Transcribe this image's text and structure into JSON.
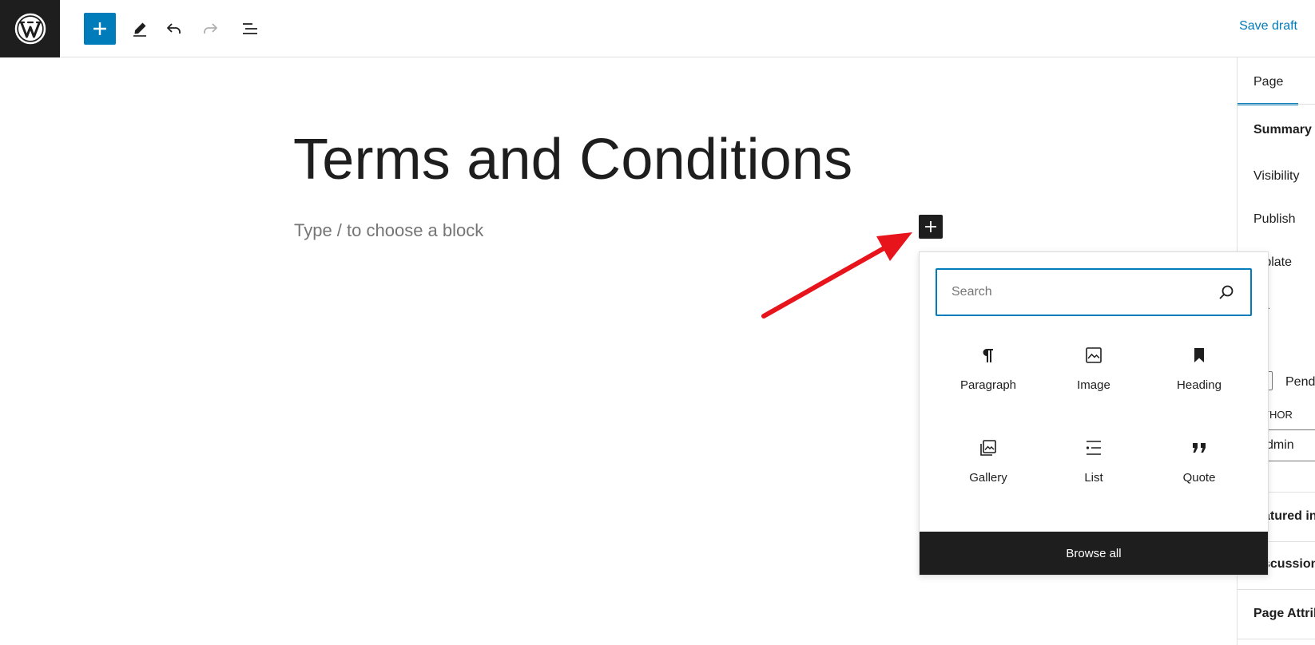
{
  "toolbar": {
    "logo": "wordpress-logo",
    "inserter_icon": "plus-icon",
    "tools_icon": "pencil-icon",
    "undo_icon": "undo-icon",
    "redo_icon": "redo-icon",
    "outline_icon": "list-view-icon",
    "save_draft_label": "Save draft"
  },
  "editor": {
    "title": "Terms and Conditions",
    "block_placeholder": "Type / to choose a block"
  },
  "sidebar": {
    "tab_page": "Page",
    "summary": "Summary",
    "visibility": "Visibility",
    "publish": "Publish",
    "template": "mplate",
    "url": "RL",
    "pending": "Pend",
    "author_label": "THOR",
    "author_value": "dmin",
    "featured_image": "atured in",
    "discussion": "scussion",
    "page_attributes": "Page Attrib"
  },
  "quick_inserter": {
    "search_placeholder": "Search",
    "search_value": "",
    "blocks": [
      {
        "label": "Paragraph",
        "icon": "paragraph-icon"
      },
      {
        "label": "Image",
        "icon": "image-icon"
      },
      {
        "label": "Heading",
        "icon": "bookmark-icon"
      },
      {
        "label": "Gallery",
        "icon": "gallery-icon"
      },
      {
        "label": "List",
        "icon": "list-icon"
      },
      {
        "label": "Quote",
        "icon": "quote-icon"
      }
    ],
    "browse_all_label": "Browse all"
  },
  "colors": {
    "accent": "#007cba",
    "dark": "#1e1e1e",
    "annotation_arrow": "#e8141b"
  }
}
